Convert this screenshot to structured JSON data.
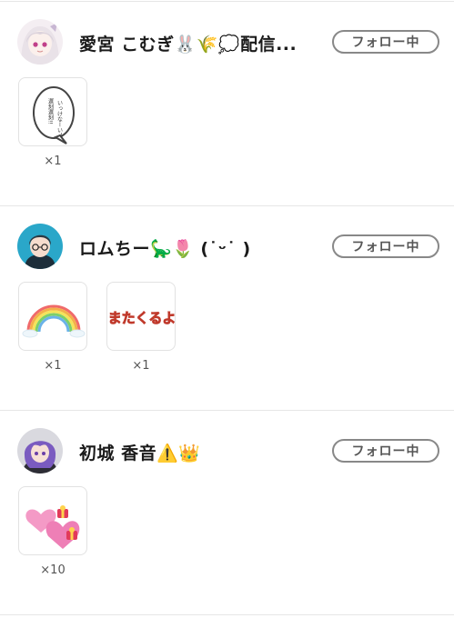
{
  "users": [
    {
      "name": "愛宮 こむぎ🐰🌾💭配信...",
      "follow_label": "フォロー中",
      "gifts": [
        {
          "icon": "speech-bubble-sticker-icon",
          "text": "いっけなーい！\n遅刻遅刻!!",
          "count": "×1"
        }
      ]
    },
    {
      "name": "ロムちー🦕🌷 (˙ᵕ˙ )",
      "follow_label": "フォロー中",
      "gifts": [
        {
          "icon": "rainbow-icon",
          "count": "×1"
        },
        {
          "icon": "matakuruyo-sticker-icon",
          "text": "またくるよ",
          "count": "×1"
        }
      ]
    },
    {
      "name": "初城 香音⚠️👑",
      "follow_label": "フォロー中",
      "gifts": [
        {
          "icon": "hearts-gift-icon",
          "count": "×10"
        }
      ]
    }
  ],
  "colors": {
    "divider": "#e6e6e6",
    "button_border": "#888888",
    "sticker_orange": "#f07a1a"
  }
}
